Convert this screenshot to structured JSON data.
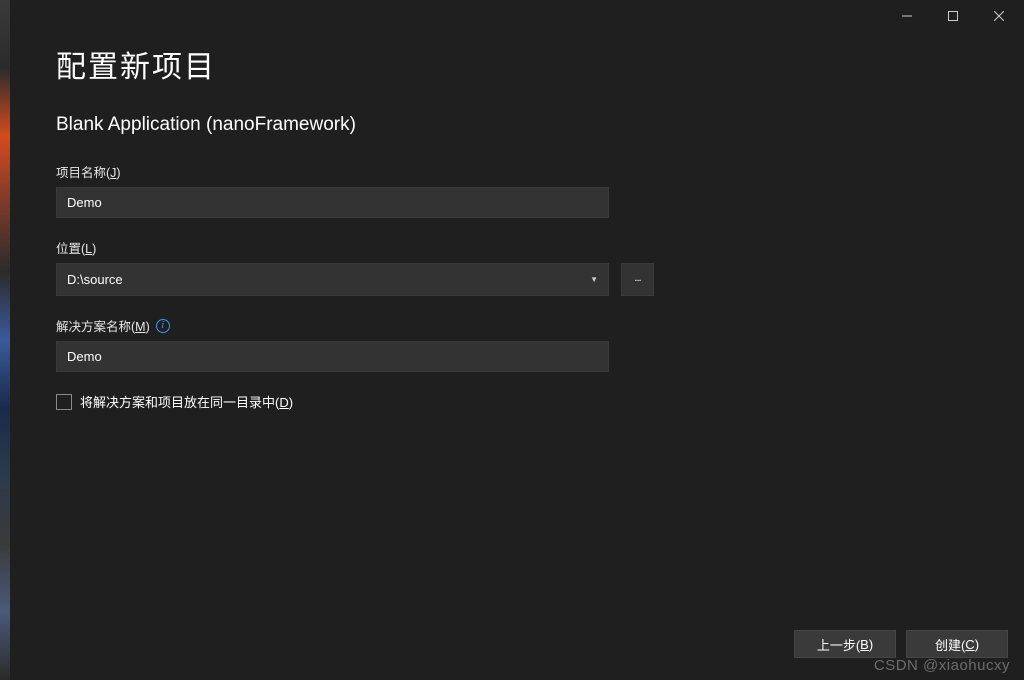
{
  "header": {
    "title": "配置新项目",
    "template": "Blank Application (nanoFramework)"
  },
  "fields": {
    "project_name": {
      "label_pre": "项目名称(",
      "label_hotkey": "J",
      "label_post": ")",
      "value": "Demo"
    },
    "location": {
      "label_pre": "位置(",
      "label_hotkey": "L",
      "label_post": ")",
      "value": "D:\\source",
      "browse_label": "..."
    },
    "solution_name": {
      "label_pre": "解决方案名称(",
      "label_hotkey": "M",
      "label_post": ")",
      "info_tooltip": "i",
      "value": "Demo"
    },
    "same_dir": {
      "label_pre": "将解决方案和项目放在同一目录中(",
      "label_hotkey": "D",
      "label_post": ")",
      "checked": false
    }
  },
  "footer": {
    "back_pre": "上一步(",
    "back_hotkey": "B",
    "back_post": ")",
    "create_pre": "创建(",
    "create_hotkey": "C",
    "create_post": ")"
  },
  "watermark": "CSDN @xiaohucxy"
}
